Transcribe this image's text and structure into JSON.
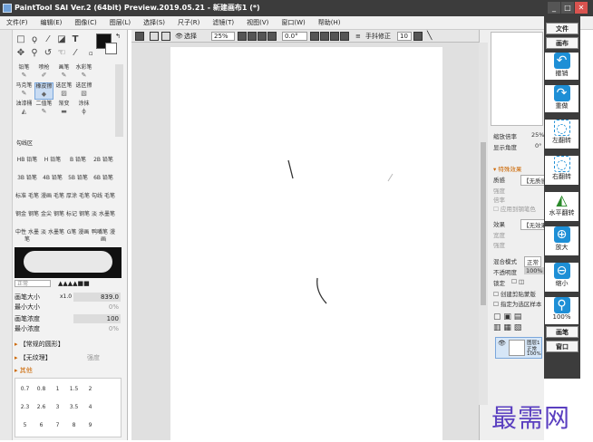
{
  "window": {
    "title": "PaintTool SAI Ver.2 (64bit) Preview.2019.05.21 - 新建画布1 (*)",
    "min": "_",
    "max": "□",
    "close": "✕"
  },
  "menu": [
    "文件(F)",
    "编辑(E)",
    "图像(C)",
    "图层(L)",
    "选择(S)",
    "尺子(R)",
    "滤镜(T)",
    "视图(V)",
    "窗口(W)",
    "帮助(H)"
  ],
  "toolbar": {
    "select_label": "选择",
    "zoom": "25%",
    "angle": "0.0°",
    "stabilizer_label": "手抖修正",
    "stabilizer_value": "10"
  },
  "brushes": [
    {
      "name": "铅笔"
    },
    {
      "name": "喷枪"
    },
    {
      "name": "画笔"
    },
    {
      "name": "水彩笔"
    },
    {
      "name": "马克笔"
    },
    {
      "name": "橡皮擦",
      "selected": true
    },
    {
      "name": "选区笔"
    },
    {
      "name": "选区擦"
    },
    {
      "name": "油漆桶"
    },
    {
      "name": "二值笔"
    },
    {
      "name": "渐变"
    },
    {
      "name": "涂抹"
    }
  ],
  "brush_group_label": "勾线区",
  "pencils": [
    [
      "HB 铅笔",
      "H 铅笔",
      "B 铅笔",
      "2B 铅笔"
    ],
    [
      "3B 铅笔",
      "4B 铅笔",
      "5B 铅笔",
      "6B 铅笔"
    ],
    [
      "标准 毛笔",
      "漫画 毛笔",
      "厚涂 毛笔",
      "勾线 毛笔"
    ],
    [
      "钢金 钢笔",
      "金尖 钢笔",
      "标记 钢笔",
      "淡 水墨笔"
    ],
    [
      "中性 水墨笔",
      "淡 水墨笔",
      "G笔 漫画",
      "鸭嘴笔 漫画"
    ]
  ],
  "brush_props": {
    "mode": "正常",
    "size_label": "画笔大小",
    "size_mult": "x1.0",
    "size": "839.0",
    "min_size_label": "最小大小",
    "min_size": "0%",
    "density_label": "画笔浓度",
    "density": "100",
    "min_density_label": "最小浓度",
    "min_density": "0%",
    "shape_label": "【常规的圆形】",
    "texture_label": "【无纹理】",
    "texture_value": "强度",
    "other_label": "其他"
  },
  "dot_sizes": [
    [
      "",
      "",
      "",
      "",
      "."
    ],
    [
      "0.7",
      "0.8",
      "1",
      "1.5",
      "2"
    ],
    [
      "2.3",
      "2.6",
      "3",
      "3.5",
      "4"
    ],
    [
      "5",
      "6",
      "7",
      "8",
      "9"
    ]
  ],
  "navigator": {
    "zoom_label": "缩放倍率",
    "zoom": "25%",
    "angle_label": "显示角度",
    "angle": "0°"
  },
  "effects": {
    "title": "特殊效果",
    "texture_label": "质感",
    "texture_value": "【无质感】",
    "strength_label": "强度",
    "scale_label": "倍率",
    "apply_label": "应用到钢笔色",
    "fx_label": "效果",
    "fx_value": "【无效果】",
    "width_label": "宽度",
    "fx_strength_label": "强度"
  },
  "layer_opts": {
    "blend_label": "混合模式",
    "blend": "正常",
    "opacity_label": "不透明度",
    "opacity": "100%",
    "lock_label": "锁定",
    "clip_label": "创建剪贴蒙版",
    "ref_label": "指定为选区样本"
  },
  "layer": {
    "name": "图层1",
    "mode": "正常",
    "opacity": "100%"
  },
  "sidebar": {
    "file": "文件",
    "canvas": "画布",
    "undo": "撤销",
    "redo": "重做",
    "rotl": "左翻转",
    "rotr": "右翻转",
    "flip": "水平翻转",
    "zoomin": "放大",
    "zoomout": "缩小",
    "zoom_pct": "100%",
    "brush": "画笔",
    "window": "窗口"
  },
  "watermark": "最需网",
  "colors": {
    "accent": "#1e8fd6",
    "titlebar": "#3c3c3c",
    "close": "#d9534f"
  }
}
